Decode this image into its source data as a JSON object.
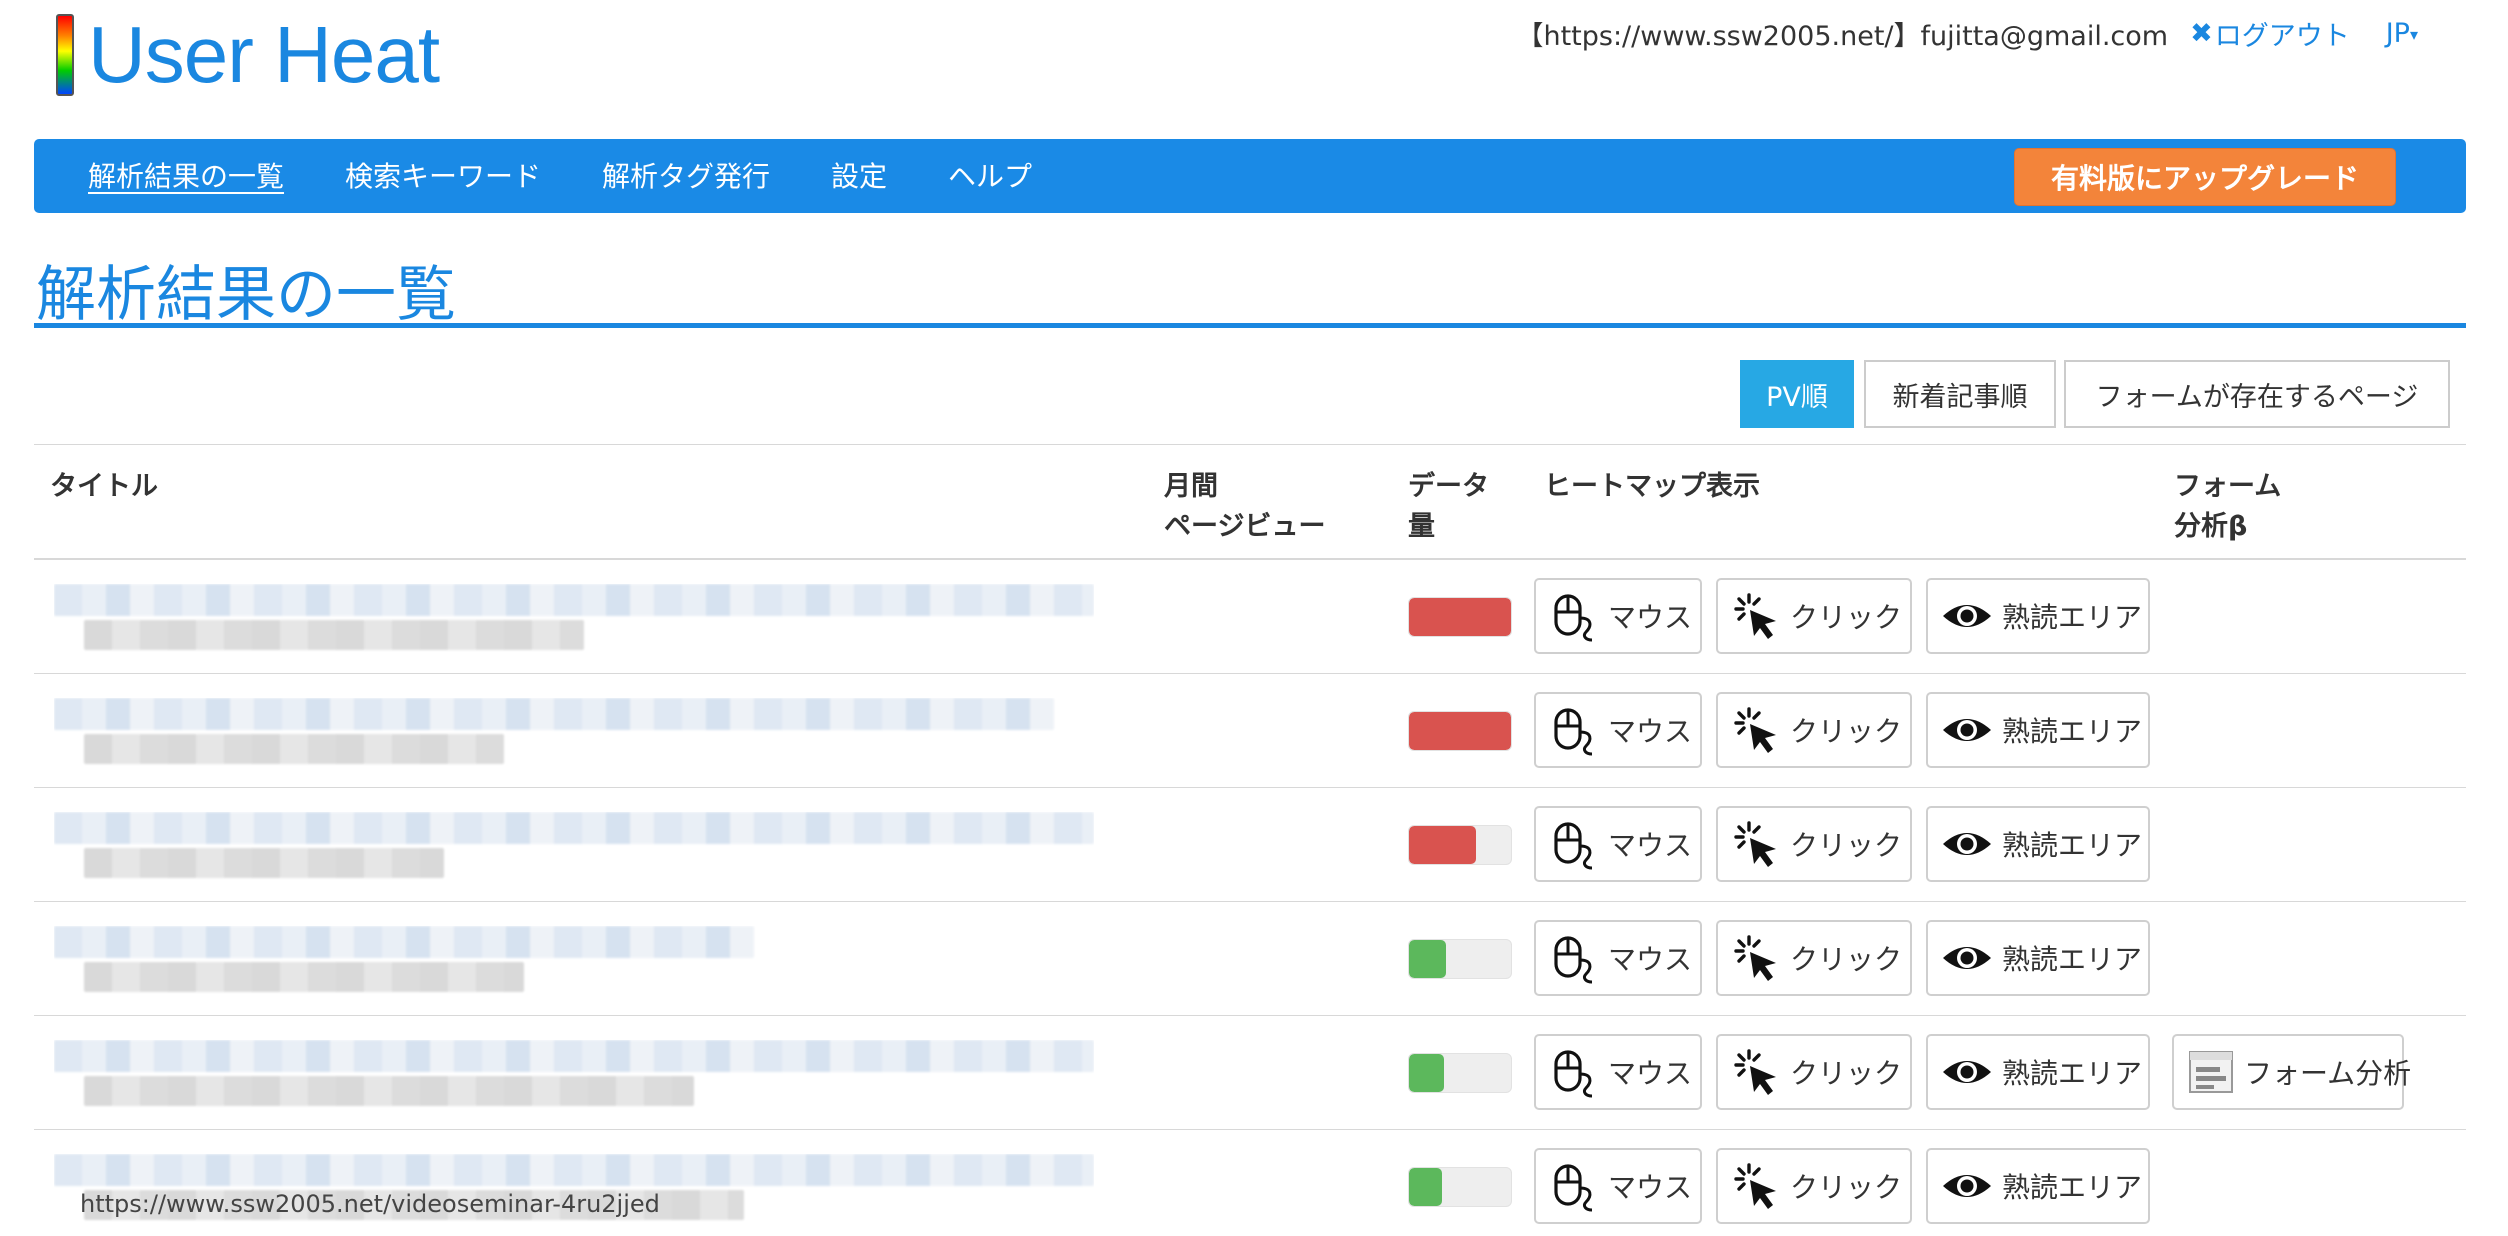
{
  "header": {
    "logo_text": "User Heat",
    "account": "【https://www.ssw2005.net/】fujitta@gmail.com",
    "logout_label": "ログアウト",
    "lang_label": "JP"
  },
  "nav": {
    "items": [
      {
        "label": "解析結果の一覧",
        "active": true
      },
      {
        "label": "検索キーワード"
      },
      {
        "label": "解析タグ発行"
      },
      {
        "label": "設定"
      },
      {
        "label": "ヘルプ"
      }
    ],
    "upgrade_label": "有料版にアップグレード"
  },
  "page_title": "解析結果の一覧",
  "sort": {
    "pv_label": "PV順",
    "new_label": "新着記事順",
    "form_label": "フォームが存在するページ"
  },
  "table": {
    "headers": {
      "title": "タイトル",
      "monthly_line1": "月間",
      "monthly_line2": "ページビュー",
      "data_line1": "データ",
      "data_line2": "量",
      "heatmap": "ヒートマップ表示",
      "form_line1": "フォーム",
      "form_line2": "分析β"
    },
    "buttons": {
      "mouse": "マウス",
      "click": "クリック",
      "read": "熟読エリア",
      "form": "フォーム分析"
    },
    "rows": [
      {
        "data_level": 1.0,
        "data_color": "#d9534f",
        "has_form": false
      },
      {
        "data_level": 1.0,
        "data_color": "#d9534f",
        "has_form": false
      },
      {
        "data_level": 0.66,
        "data_color": "#d9534f",
        "has_form": false
      },
      {
        "data_level": 0.36,
        "data_color": "#5cb85c",
        "has_form": false
      },
      {
        "data_level": 0.34,
        "data_color": "#5cb85c",
        "has_form": true
      },
      {
        "data_level": 0.32,
        "data_color": "#5cb85c",
        "has_form": false
      }
    ],
    "last_row_url": "https://www.ssw2005.net/videoseminar-4ru2jjed"
  }
}
